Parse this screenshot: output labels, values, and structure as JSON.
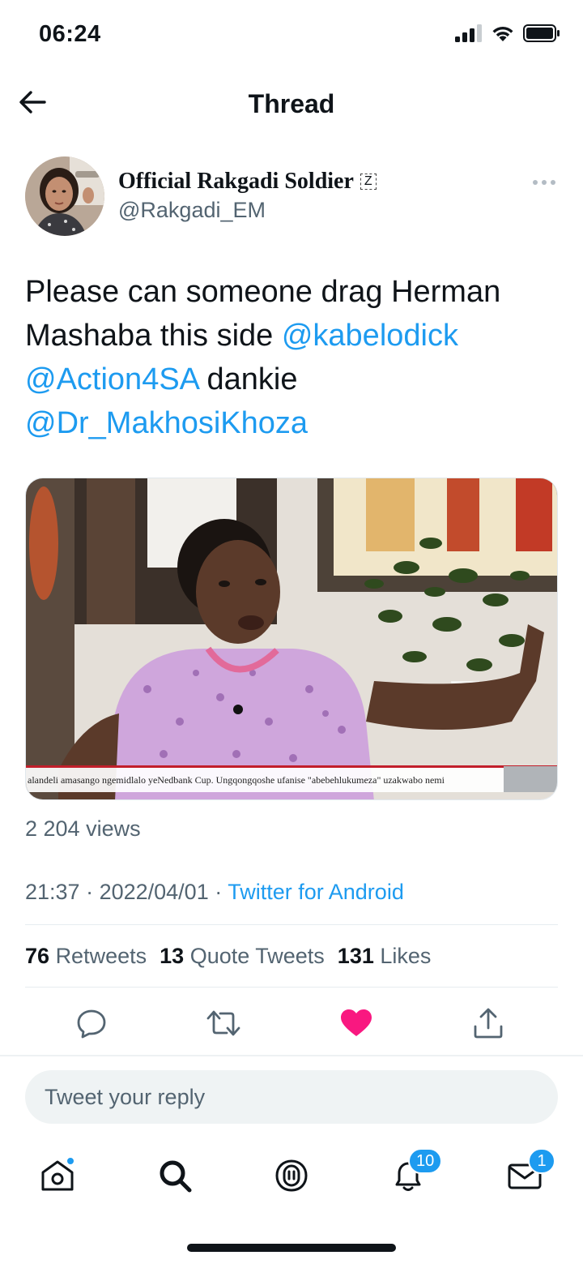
{
  "status_bar": {
    "time": "06:24"
  },
  "header": {
    "title": "Thread",
    "back_icon": "arrow-left-icon"
  },
  "tweet": {
    "display_name": "Official Rakgadi Soldier",
    "name_badge": "Z",
    "handle": "@Rakgadi_EM",
    "text_parts": {
      "p1": "Please can someone drag Herman Mashaba this side ",
      "m1": "@kabelodick",
      "sp1": " ",
      "m2": "@Action4SA",
      "p2": " dankie ",
      "m3": "@Dr_MakhosiKhoza"
    },
    "media_ticker": "alandeli amasango ngemidlalo yeNedbank Cup. Ungqongqoshe ufanise \"abebehlukumeza\" uzakwabo nemi",
    "views": "2 204 views",
    "time": "21:37",
    "date": "2022/04/01",
    "separator": " · ",
    "source": "Twitter for Android",
    "stats": {
      "retweets_count": "76",
      "retweets_label": "Retweets",
      "quotes_count": "13",
      "quotes_label": "Quote Tweets",
      "likes_count": "131",
      "likes_label": "Likes"
    }
  },
  "actions": [
    "reply-icon",
    "retweet-icon",
    "heart-filled-icon",
    "share-icon"
  ],
  "reply": {
    "placeholder": "Tweet your reply"
  },
  "bottom_nav": {
    "notifications_badge": "10",
    "messages_badge": "1"
  },
  "colors": {
    "accent": "#1d9bf0",
    "like": "#f91880",
    "secondary_text": "#536471"
  }
}
